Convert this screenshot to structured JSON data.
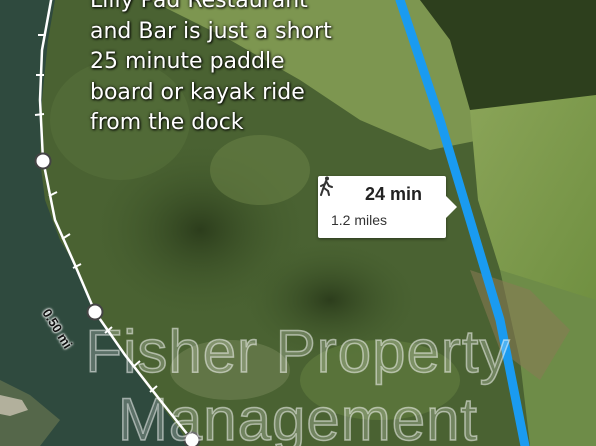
{
  "caption": {
    "lines": [
      "Lilly Pad Restaurant",
      "and Bar is just a short",
      "25 minute paddle",
      "board or kayak ride",
      "from the dock"
    ]
  },
  "route_info": {
    "mode_icon": "walking-person-icon",
    "duration": "24 min",
    "distance": "1.2 miles"
  },
  "measure_path": {
    "label": "0.50 mi"
  },
  "watermark": {
    "lines": [
      "Fisher Property",
      "Management"
    ]
  },
  "colors": {
    "route_blue": "#1a9bf0",
    "water": "#2f4a3e",
    "forest": "#3c5128",
    "field": "#7e9a4a",
    "measure_line": "#ffffff"
  }
}
